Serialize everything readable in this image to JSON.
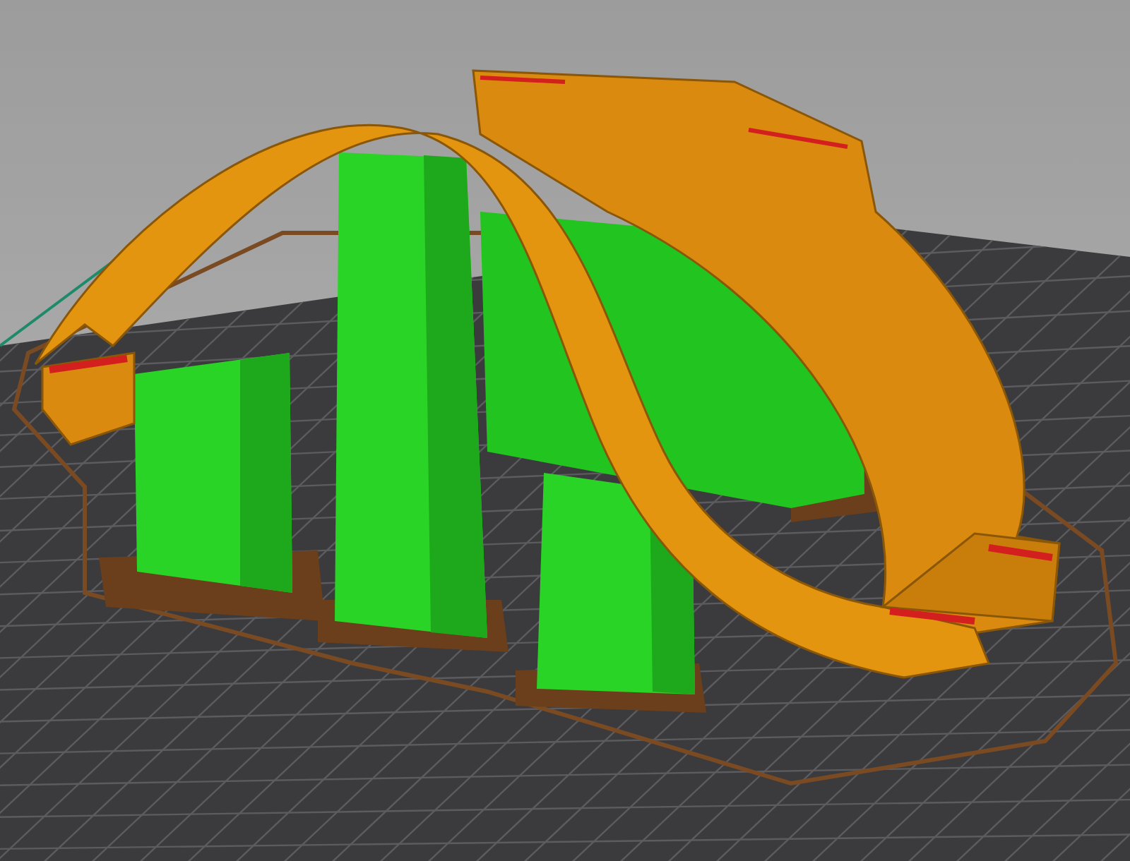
{
  "viewport": {
    "show_grid": true,
    "show_supports": true,
    "show_skirt": true
  }
}
